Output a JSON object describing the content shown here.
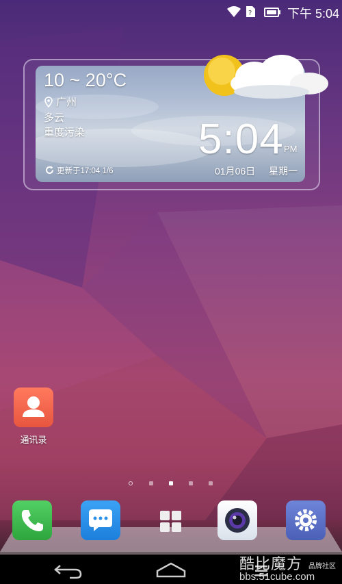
{
  "status_bar": {
    "time": "下午 5:04",
    "icons": [
      "wifi-icon",
      "sim-icon",
      "battery-icon"
    ]
  },
  "weather_widget": {
    "temperature": "10 ~ 20°C",
    "city": "广州",
    "condition": "多云",
    "pollution": "重度污染",
    "updated": "更新于17:04 1/6",
    "clock": "5:04",
    "ampm": "PM",
    "date": "01月06日",
    "weekday": "星期一"
  },
  "home_apps": [
    {
      "label": "通讯录",
      "icon": "contacts-icon",
      "color": "#f0644c"
    }
  ],
  "page_indicator": {
    "count": 5,
    "current": 3
  },
  "dock": [
    {
      "icon": "phone-icon",
      "color": "#3dba4a"
    },
    {
      "icon": "messages-icon",
      "color": "#2b8fe8"
    },
    {
      "icon": "app-drawer-icon",
      "color": "#ffffff"
    },
    {
      "icon": "camera-icon",
      "color": "#e9eef5"
    },
    {
      "icon": "settings-icon",
      "color": "#5a70c8"
    }
  ],
  "nav_bar": {
    "icons": [
      "back-icon",
      "home-icon",
      "menu-icon"
    ]
  },
  "watermark": {
    "text": "酷比魔方",
    "tag": "品牌社区",
    "url": "bbs.51cube.com"
  }
}
